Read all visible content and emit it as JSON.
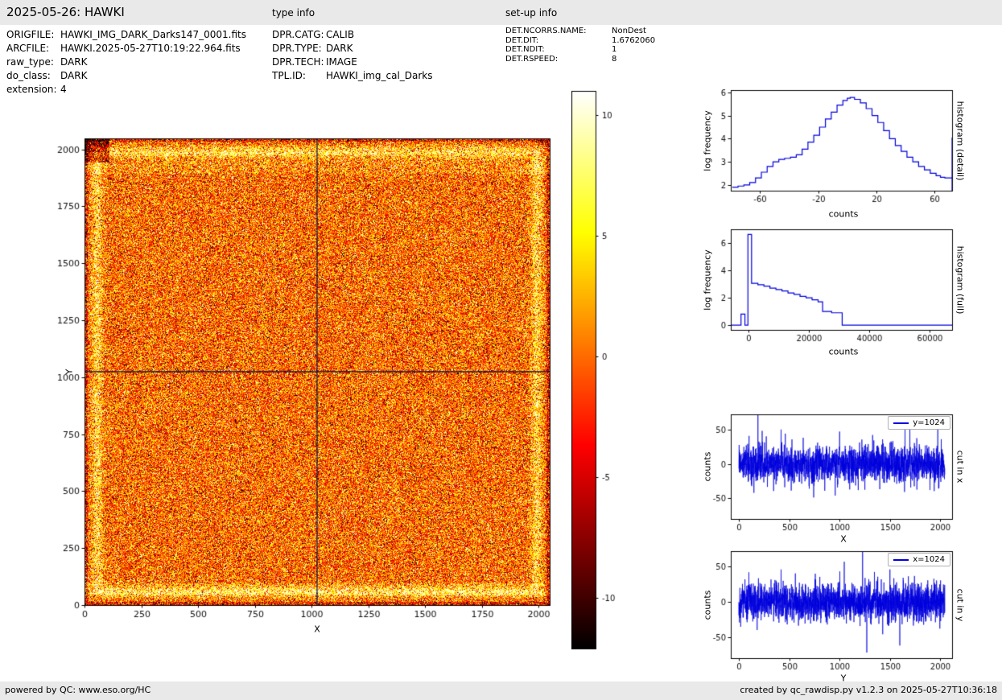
{
  "header": {
    "title": "2025-05-26: HAWKI",
    "type_info_heading": "type info",
    "setup_info_heading": "set-up info"
  },
  "file_info": {
    "rows": [
      {
        "label": "ORIGFILE:",
        "value": "HAWKI_IMG_DARK_Darks147_0001.fits"
      },
      {
        "label": "ARCFILE:",
        "value": "HAWKI.2025-05-27T10:19:22.964.fits"
      },
      {
        "label": "raw_type:",
        "value": "DARK"
      },
      {
        "label": "do_class:",
        "value": "DARK"
      },
      {
        "label": "extension:",
        "value": "4"
      }
    ]
  },
  "type_info": {
    "rows": [
      {
        "label": "DPR.CATG:",
        "value": "CALIB"
      },
      {
        "label": "DPR.TYPE:",
        "value": "DARK"
      },
      {
        "label": "DPR.TECH:",
        "value": "IMAGE"
      },
      {
        "label": "TPL.ID:",
        "value": "HAWKI_img_cal_Darks"
      }
    ]
  },
  "setup_info": {
    "rows": [
      {
        "label": "DET.NCORRS.NAME:",
        "value": "NonDest"
      },
      {
        "label": "DET.DIT:",
        "value": "1.6762060"
      },
      {
        "label": "DET.NDIT:",
        "value": "1"
      },
      {
        "label": "DET.RSPEED:",
        "value": "8"
      }
    ]
  },
  "footer": {
    "left": "powered by QC: www.eso.org/HC",
    "right": "created by qc_rawdisp.py v1.2.3 on 2025-05-27T10:36:18"
  },
  "chart_data": [
    {
      "id": "main_image",
      "type": "heatmap",
      "xlabel": "X",
      "ylabel": "Y",
      "xlim": [
        0,
        2048
      ],
      "ylim": [
        0,
        2048
      ],
      "xticks": [
        0,
        250,
        500,
        750,
        1000,
        1250,
        1500,
        1750,
        2000
      ],
      "yticks": [
        0,
        250,
        500,
        750,
        1000,
        1250,
        1500,
        1750,
        2000
      ],
      "colormap": "hot",
      "vmin": -12.1,
      "vmax": 11.0,
      "colorbar_ticks": [
        10,
        5,
        0,
        -5,
        -10
      ],
      "noise_sigma": 4.3,
      "seed": 7,
      "crosshair_x": 1024,
      "crosshair_y": 1024,
      "description": "2048x2048 HAWKI raw dark frame shown with hot colormap: orange Gaussian noise speckle (~0 counts mean), bright speckled rim ring inset ~55 px from all edges, extra bright band near bottom rows, dark outermost edges, dark black blotch in top-left corner, dark navy crosshair lines at x=1024 and y=1024"
    },
    {
      "id": "hist_detail",
      "type": "step-histogram",
      "xlabel": "counts",
      "ylabel": "log frequency",
      "right_label": "histogram (detail)",
      "color": "#0000dd",
      "xlim": [
        -80,
        72
      ],
      "ylim": [
        1.75,
        6.1
      ],
      "xticks": [
        -60,
        -20,
        20,
        60
      ],
      "yticks": [
        2,
        3,
        4,
        5,
        6
      ],
      "close_right": true,
      "points": [
        [
          -79,
          1.9
        ],
        [
          -75,
          1.95
        ],
        [
          -71,
          2.0
        ],
        [
          -67,
          2.1
        ],
        [
          -63,
          2.3
        ],
        [
          -59,
          2.55
        ],
        [
          -55,
          2.8
        ],
        [
          -51,
          3.0
        ],
        [
          -47,
          3.1
        ],
        [
          -43,
          3.15
        ],
        [
          -39,
          3.2
        ],
        [
          -35,
          3.3
        ],
        [
          -31,
          3.55
        ],
        [
          -27,
          3.85
        ],
        [
          -23,
          4.15
        ],
        [
          -19,
          4.5
        ],
        [
          -15,
          4.85
        ],
        [
          -11,
          5.15
        ],
        [
          -7,
          5.45
        ],
        [
          -3,
          5.65
        ],
        [
          0,
          5.75
        ],
        [
          2,
          5.78
        ],
        [
          5,
          5.7
        ],
        [
          9,
          5.55
        ],
        [
          13,
          5.3
        ],
        [
          17,
          5.0
        ],
        [
          21,
          4.7
        ],
        [
          25,
          4.35
        ],
        [
          29,
          4.0
        ],
        [
          33,
          3.7
        ],
        [
          37,
          3.45
        ],
        [
          41,
          3.2
        ],
        [
          45,
          3.0
        ],
        [
          49,
          2.8
        ],
        [
          53,
          2.65
        ],
        [
          57,
          2.5
        ],
        [
          61,
          2.4
        ],
        [
          64,
          2.33
        ],
        [
          67,
          2.3
        ],
        [
          72,
          4.05
        ]
      ]
    },
    {
      "id": "hist_full",
      "type": "step-histogram",
      "xlabel": "counts",
      "ylabel": "log frequency",
      "right_label": "histogram (full)",
      "color": "#0000dd",
      "xlim": [
        -6000,
        67500
      ],
      "ylim": [
        -0.35,
        7.0
      ],
      "xticks": [
        0,
        20000,
        40000,
        60000
      ],
      "yticks": [
        0,
        2,
        4,
        6
      ],
      "close_right": false,
      "points": [
        [
          -6000,
          0
        ],
        [
          -2600,
          0.8
        ],
        [
          -1300,
          0
        ],
        [
          -300,
          6.62
        ],
        [
          900,
          3.05
        ],
        [
          3000,
          2.95
        ],
        [
          5000,
          2.85
        ],
        [
          7000,
          2.7
        ],
        [
          9000,
          2.6
        ],
        [
          11000,
          2.5
        ],
        [
          13000,
          2.35
        ],
        [
          15000,
          2.25
        ],
        [
          17000,
          2.1
        ],
        [
          19000,
          2.0
        ],
        [
          21000,
          1.85
        ],
        [
          23000,
          1.7
        ],
        [
          24500,
          1.0
        ],
        [
          27500,
          0.9
        ],
        [
          31000,
          0
        ],
        [
          67500,
          0
        ]
      ]
    },
    {
      "id": "cut_x",
      "type": "line",
      "xlabel": "X",
      "ylabel": "counts",
      "right_label": "cut in x",
      "legend": "y=1024",
      "color": "#0000dd",
      "xlim": [
        -80,
        2120
      ],
      "ylim": [
        -80,
        72
      ],
      "xticks": [
        0,
        500,
        1000,
        1500,
        2000
      ],
      "yticks": [
        -50,
        0,
        50
      ],
      "n": 2048,
      "noise_sigma": 13,
      "seed": 101,
      "spikes": [
        [
          150,
          -42
        ],
        [
          190,
          92
        ],
        [
          232,
          48
        ],
        [
          420,
          50
        ],
        [
          462,
          44
        ],
        [
          640,
          38
        ],
        [
          700,
          -36
        ],
        [
          958,
          -46
        ],
        [
          1002,
          47
        ],
        [
          1330,
          42
        ],
        [
          1652,
          55
        ],
        [
          1700,
          68
        ],
        [
          1900,
          -38
        ],
        [
          1978,
          60
        ]
      ],
      "description": "Row cut at y=1024: Gaussian noise around 0 counts (sigma ~13) with isolated hot/cold pixel spikes"
    },
    {
      "id": "cut_y",
      "type": "line",
      "xlabel": "Y",
      "ylabel": "counts",
      "right_label": "cut in y",
      "legend": "x=1024",
      "color": "#0000dd",
      "xlim": [
        -80,
        2120
      ],
      "ylim": [
        -80,
        72
      ],
      "xticks": [
        0,
        500,
        1000,
        1500,
        2000
      ],
      "yticks": [
        -50,
        0,
        50
      ],
      "n": 2048,
      "noise_sigma": 13,
      "seed": 202,
      "spikes": [
        [
          100,
          42
        ],
        [
          182,
          -40
        ],
        [
          420,
          46
        ],
        [
          760,
          40
        ],
        [
          1048,
          57
        ],
        [
          1230,
          96
        ],
        [
          1272,
          -72
        ],
        [
          1430,
          -46
        ],
        [
          1502,
          46
        ],
        [
          1600,
          -62
        ],
        [
          1998,
          -38
        ]
      ],
      "description": "Column cut at x=1024: Gaussian noise around 0 counts (sigma ~13) with isolated hot/cold pixel spikes"
    }
  ]
}
